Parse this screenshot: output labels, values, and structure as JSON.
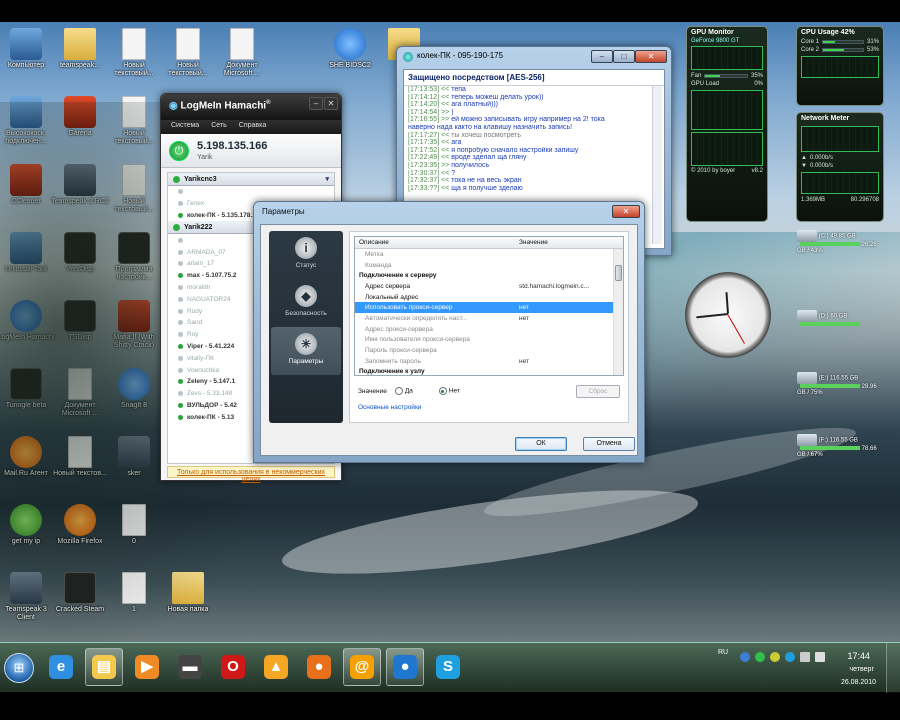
{
  "desktop_icons": [
    {
      "label": "Компьютер",
      "icon": "computer-icon",
      "style": "pc"
    },
    {
      "label": "teamspeak...",
      "icon": "folder-icon",
      "style": "folder"
    },
    {
      "label": "Новый текстовый...",
      "icon": "text-document-icon",
      "style": "doc"
    },
    {
      "label": "Новый текстовый...",
      "icon": "text-document-icon",
      "style": "doc"
    },
    {
      "label": "Документ Microsoft ...",
      "icon": "word-document-icon",
      "style": "doc"
    },
    {
      "label": "SHE BIDSC2",
      "icon": "shortcut-icon",
      "style": "blue"
    },
    {
      "label": "Дуэ",
      "icon": "folder-icon",
      "style": "folder"
    },
    {
      "label": "Высококоск. подключен...",
      "icon": "network-connection-icon",
      "style": "pc"
    },
    {
      "label": "Garena",
      "icon": "garena-icon",
      "style": "red"
    },
    {
      "label": "Новый текстовый...",
      "icon": "text-document-icon",
      "style": "doc"
    },
    {
      "label": "CCleaner",
      "icon": "ccleaner-icon",
      "style": "red"
    },
    {
      "label": "Teamspeak 2 RC2",
      "icon": "teamspeak-icon",
      "style": "ts"
    },
    {
      "label": "Новый текстовый...",
      "icon": "text-document-icon",
      "style": "doc"
    },
    {
      "label": "Uninstall Tool",
      "icon": "uninstall-tool-icon",
      "style": "pc"
    },
    {
      "label": "VentDisp",
      "icon": "ventdisp-icon",
      "style": "dark"
    },
    {
      "label": "Программа настройк...",
      "icon": "settings-program-icon",
      "style": "dark"
    },
    {
      "label": "LogMeIn Hamachi",
      "icon": "hamachi-icon",
      "style": "blue"
    },
    {
      "label": "TSDisp",
      "icon": "tsdisp-icon",
      "style": "dark"
    },
    {
      "label": "Mafia II (With Shitty Crack)",
      "icon": "mafia-icon",
      "style": "red"
    },
    {
      "label": "Tunngle beta",
      "icon": "tunngle-icon",
      "style": "dark"
    },
    {
      "label": "Документ Microsoft ...",
      "icon": "word-document-icon",
      "style": "doc"
    },
    {
      "label": "SnagIt 8",
      "icon": "snagit-icon",
      "style": "blue"
    },
    {
      "label": "Mail.Ru Агент",
      "icon": "mailru-agent-icon",
      "style": "orange"
    },
    {
      "label": "Новый текстов...",
      "icon": "text-document-icon",
      "style": "doc"
    },
    {
      "label": "sker",
      "icon": "winrar-icon",
      "style": "ts"
    },
    {
      "label": "get my ip",
      "icon": "globe-icon",
      "style": "green"
    },
    {
      "label": "Mozilla Firefox",
      "icon": "firefox-icon",
      "style": "orange"
    },
    {
      "label": "0",
      "icon": "video-file-icon",
      "style": "doc"
    },
    {
      "label": "Teamspeak 3 Client",
      "icon": "teamspeak3-icon",
      "style": "ts"
    },
    {
      "label": "Cracked Steam",
      "icon": "steam-icon",
      "style": "dark"
    },
    {
      "label": "1",
      "icon": "video-file-icon",
      "style": "doc"
    },
    {
      "label": "Новая папка",
      "icon": "folder-icon",
      "style": "folder"
    }
  ],
  "gadgets": {
    "gpu": {
      "title": "GPU Monitor",
      "model": "GeForce 9800 GT",
      "temp_label": "GPU Load",
      "load": "0%",
      "fan": "35%",
      "footer": "© 2010 by boyer",
      "version": "v8.2",
      "fan_fill": 0.35
    },
    "cpu": {
      "title": "CPU Usage 42%",
      "core1": "Core 1",
      "core2": "Core 2",
      "core1_val": "31%",
      "core2_val": "53%",
      "core1_fill": 0.31,
      "core2_fill": 0.53
    },
    "net": {
      "title": "Network Meter",
      "up": "0.000b/s",
      "down": "0.000b/s",
      "total_up": "1.369MB",
      "total_down": "80.296708"
    },
    "drives": [
      {
        "label": "(C:) 49.85 GB",
        "free": "26.28 GB / 43%"
      },
      {
        "label": "(D:) 60 GB",
        "free": ""
      },
      {
        "label": "(E:) 116.55 GB",
        "free": "28.96 GB / 75%"
      },
      {
        "label": "(F:) 116.55 GB",
        "free": "78.66 GB / 67%"
      }
    ]
  },
  "chat": {
    "title": "колек-ПК - 095-190-175",
    "header": "Защищено посредством [AES-256]",
    "lines": [
      {
        "time": "[17:13:53]",
        "dir": "<<",
        "text": "тепа",
        "cls": "m"
      },
      {
        "time": "[17:14:12]",
        "dir": "<<",
        "text": "теперь можеш делать урок))",
        "cls": "m"
      },
      {
        "time": "[17:14:20]",
        "dir": "<<",
        "text": "ага платный)))",
        "cls": "m"
      },
      {
        "time": "[17:14:54]",
        "dir": ">>",
        "text": ")",
        "cls": "m"
      },
      {
        "time": "[17:16:55]",
        "dir": ">>",
        "text": "ей можно записывать игру например на 2! тока",
        "cls": "m"
      },
      {
        "time": "",
        "dir": "",
        "text": "наверно нада както на клавишу назначить запись!",
        "cls": "m"
      },
      {
        "time": "[17:17:27]",
        "dir": "<<",
        "text": "ты хочеш посмотреть",
        "cls": "m2"
      },
      {
        "time": "[17:17:35]",
        "dir": "<<",
        "text": "ага",
        "cls": "m"
      },
      {
        "time": "[17:17:52]",
        "dir": "<<",
        "text": "я попробую сначало настройки запишу",
        "cls": "m"
      },
      {
        "time": "[17:22:49]",
        "dir": "<<",
        "text": "вроде зделал ща гляну",
        "cls": "m"
      },
      {
        "time": "[17:23:35]",
        "dir": ">>",
        "text": "получилось",
        "cls": "m"
      },
      {
        "time": "[17:30:37]",
        "dir": "<<",
        "text": "?",
        "cls": "m"
      },
      {
        "time": "[17:32:37]",
        "dir": "<<",
        "text": "тока не на весь экран",
        "cls": "m"
      },
      {
        "time": "[17:33:??]",
        "dir": "<<",
        "text": "ща я получше зделаю",
        "cls": "m"
      }
    ]
  },
  "hamachi": {
    "title": "LogMeIn Hamachi",
    "menu": [
      "Система",
      "Сеть",
      "Справка"
    ],
    "ip": "5.198.135.166",
    "nickname": "Yarik",
    "networks": [
      {
        "name": "Yarikcnc3",
        "peers": [
          {
            "name": "",
            "online": false
          },
          {
            "name": "Гелех",
            "online": false
          },
          {
            "name": "колек-ПК - 5.135.178.175",
            "online": true
          }
        ]
      },
      {
        "name": "Yarik222",
        "peers": [
          {
            "name": "",
            "online": false
          },
          {
            "name": "ARMADA_07",
            "online": false
          },
          {
            "name": "arlam_17",
            "online": false
          },
          {
            "name": "max - 5.107.75.2",
            "online": true
          },
          {
            "name": "moralith",
            "online": false
          },
          {
            "name": "NAGUATOR24",
            "online": false
          },
          {
            "name": "Rudy",
            "online": false
          },
          {
            "name": "Sand",
            "online": false
          },
          {
            "name": "Roy",
            "online": false
          },
          {
            "name": "Viper - 5.41.224",
            "online": true
          },
          {
            "name": "vitaliy-ПК",
            "online": false
          },
          {
            "name": "Voenuchka",
            "online": false
          },
          {
            "name": "Zeleny - 5.147.1",
            "online": true
          },
          {
            "name": "Zevs - 5.33.148",
            "online": false
          },
          {
            "name": "ВУЛЬДОР - 5.42",
            "online": true
          },
          {
            "name": "колек-ПК - 5.13",
            "online": true
          }
        ]
      }
    ],
    "footer_link": "Только для использования в некоммерческих целях"
  },
  "params": {
    "title": "Параметры",
    "nav": [
      {
        "label": "Статус",
        "glyph": "i",
        "active": false
      },
      {
        "label": "Безопасность",
        "glyph": "◆",
        "active": false
      },
      {
        "label": "Параметры",
        "glyph": "✳",
        "active": true
      }
    ],
    "col_desc": "Описание",
    "col_value": "Значение",
    "rows": [
      {
        "desc": "Метка",
        "value": "",
        "type": "dim"
      },
      {
        "desc": "Команда",
        "value": "",
        "type": "dim"
      },
      {
        "desc": "Подключение к серверу",
        "value": "",
        "type": "sec"
      },
      {
        "desc": "Адрес сервера",
        "value": "std.hamachi.logmein.c...",
        "type": ""
      },
      {
        "desc": "Локальный адрес",
        "value": "",
        "type": ""
      },
      {
        "desc": "Использовать прокси-сервер",
        "value": "нет",
        "type": "sel"
      },
      {
        "desc": "Автоматически определять наст...",
        "value": "нет",
        "type": "dim"
      },
      {
        "desc": "Адрес прокси-сервера",
        "value": "",
        "type": "dim"
      },
      {
        "desc": "Имя пользователя прокси-сервера",
        "value": "",
        "type": "dim"
      },
      {
        "desc": "Пароль прокси-сервера",
        "value": "",
        "type": "dim"
      },
      {
        "desc": "Запомнить пароль",
        "value": "нет",
        "type": "dim"
      },
      {
        "desc": "Подключение к узлу",
        "value": "",
        "type": "sec"
      }
    ],
    "value_label": "Значение",
    "opt_yes": "Да",
    "opt_no": "Нет",
    "selected": "no",
    "reset": "Сброс",
    "basic_link": "Основные настройки",
    "ok": "ОК",
    "cancel": "Отмена"
  },
  "taskbar": {
    "items": [
      {
        "icon": "internet-explorer-icon",
        "glyph": "e",
        "active": false,
        "color": "#2f8fe0"
      },
      {
        "icon": "explorer-folder-icon",
        "glyph": "▤",
        "active": true,
        "color": "#f2c94c"
      },
      {
        "icon": "media-player-icon",
        "glyph": "▶",
        "active": false,
        "color": "#f08a24"
      },
      {
        "icon": "gpu-tool-icon",
        "glyph": "▬",
        "active": false,
        "color": "#444"
      },
      {
        "icon": "opera-icon",
        "glyph": "O",
        "active": false,
        "color": "#d01818"
      },
      {
        "icon": "aimp-icon",
        "glyph": "▲",
        "active": false,
        "color": "#f5a623"
      },
      {
        "icon": "firefox-icon",
        "glyph": "●",
        "active": false,
        "color": "#e8701a"
      },
      {
        "icon": "mailru-agent-icon",
        "glyph": "@",
        "active": true,
        "color": "#f6a000"
      },
      {
        "icon": "hamachi-icon",
        "glyph": "●",
        "active": true,
        "color": "#1f77d0"
      },
      {
        "icon": "skype-icon",
        "glyph": "S",
        "active": false,
        "color": "#1ea0e0"
      }
    ],
    "lang": "RU",
    "time": "17:44",
    "day": "четверг",
    "date": "26.08.2010"
  }
}
